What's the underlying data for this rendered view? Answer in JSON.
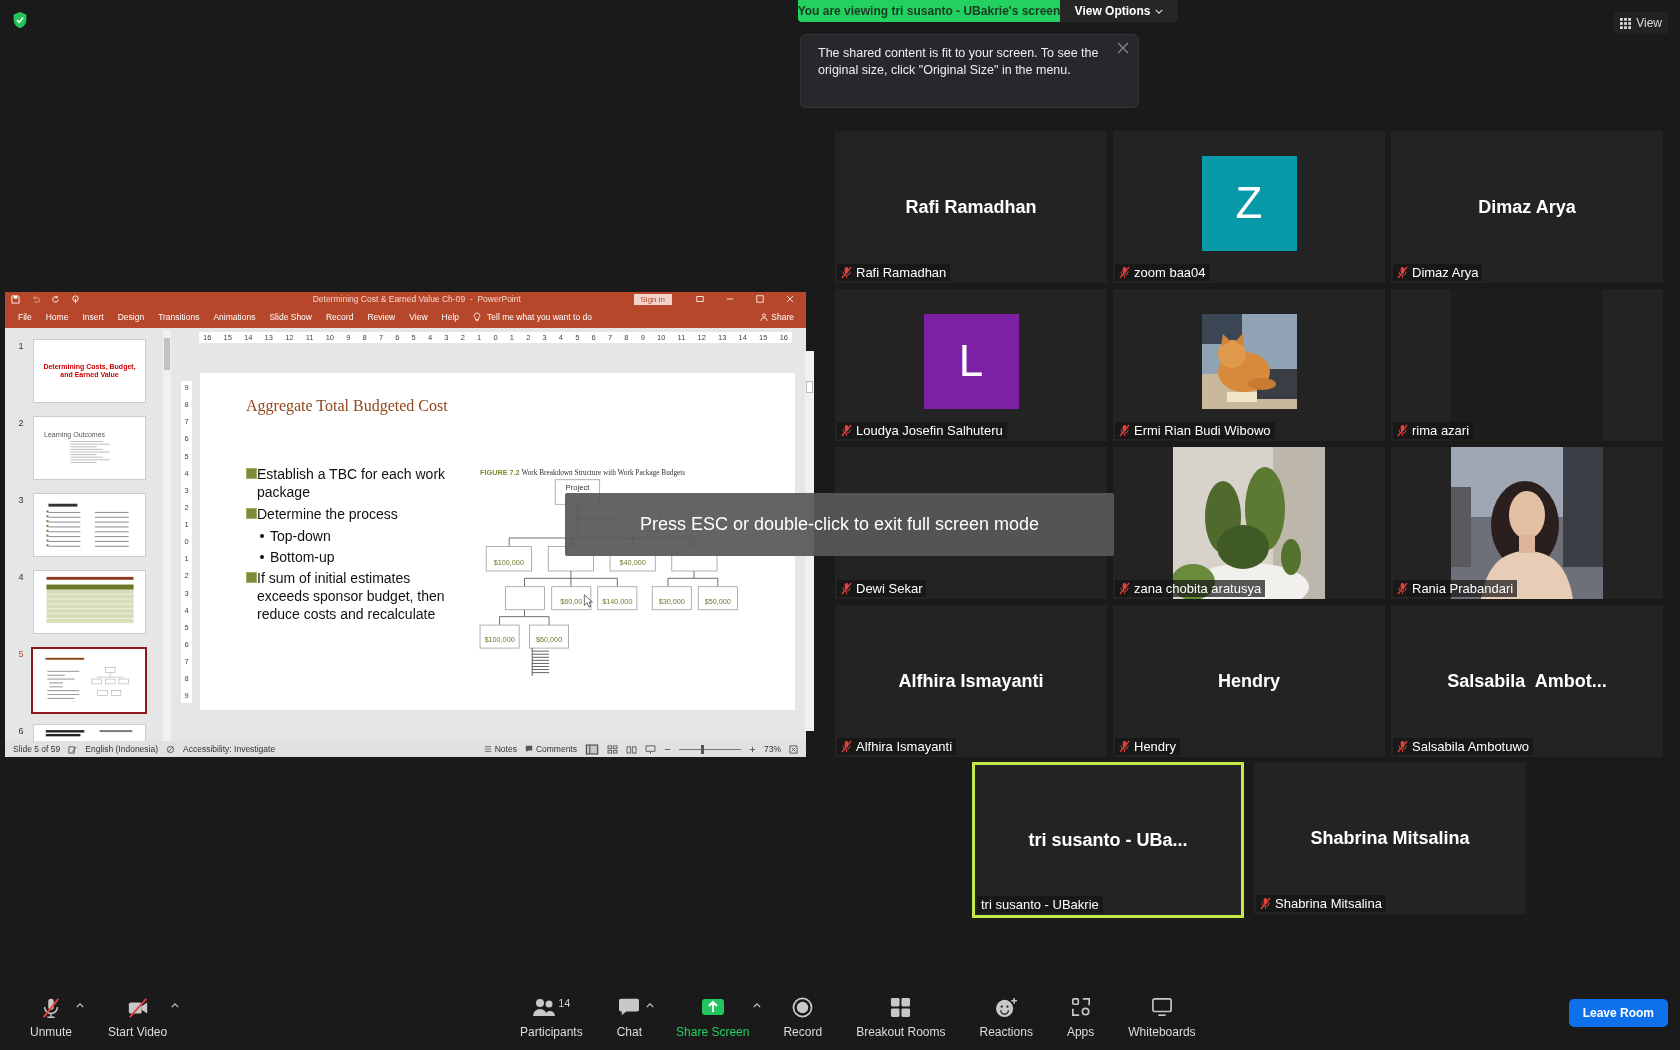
{
  "banner": {
    "text": "You are viewing tri susanto - UBakrie's screen",
    "options": "View Options"
  },
  "tooltip": {
    "text": "The shared content is fit to your screen. To see the original size, click \"Original Size\" in the menu."
  },
  "view_button": "View",
  "fullscreen_hint": "Press ESC or double-click to exit full screen mode",
  "powerpoint": {
    "title": "Determining Cost & Earned Value Ch-09  -  PowerPoint",
    "sign_in": "Sign in",
    "tabs": [
      "File",
      "Home",
      "Insert",
      "Design",
      "Transitions",
      "Animations",
      "Slide Show",
      "Record",
      "Review",
      "View",
      "Help"
    ],
    "tell_me": "Tell me what you want to do",
    "share": "Share",
    "thumbnails": [
      {
        "number": "1",
        "kind": "title",
        "title": "Determining Costs, Budget, and Earned Value",
        "selected": false
      },
      {
        "number": "2",
        "kind": "bullets",
        "title": "Learning Outcomes",
        "selected": false
      },
      {
        "number": "3",
        "kind": "columns",
        "selected": false
      },
      {
        "number": "4",
        "kind": "table",
        "selected": false
      },
      {
        "number": "5",
        "kind": "diagram",
        "selected": true
      },
      {
        "number": "6",
        "kind": "heading",
        "selected": false
      }
    ],
    "ruler_h": [
      "16",
      "15",
      "14",
      "13",
      "12",
      "11",
      "10",
      "9",
      "8",
      "7",
      "6",
      "5",
      "4",
      "3",
      "2",
      "1",
      "0",
      "1",
      "2",
      "3",
      "4",
      "5",
      "6",
      "7",
      "8",
      "9",
      "10",
      "11",
      "12",
      "13",
      "14",
      "15",
      "16"
    ],
    "ruler_v": [
      "9",
      "8",
      "7",
      "6",
      "5",
      "4",
      "3",
      "2",
      "1",
      "0",
      "1",
      "2",
      "3",
      "4",
      "5",
      "6",
      "7",
      "8",
      "9"
    ],
    "slide": {
      "title": "Aggregate Total Budgeted Cost",
      "bullets": [
        {
          "kind": "main",
          "text": "Establish a TBC for each work package"
        },
        {
          "kind": "main",
          "text": "Determine the process"
        },
        {
          "kind": "sub",
          "text": "Top-down"
        },
        {
          "kind": "sub",
          "text": "Bottom-up"
        },
        {
          "kind": "main",
          "text": "If sum of initial estimates exceeds sponsor budget, then reduce costs and recalculate"
        }
      ],
      "figure": {
        "label": "FIGURE 7.2",
        "caption": "Work Breakdown Structure with Work Package Budgets",
        "nodes": [
          {
            "kind": "labeled",
            "label": "Project"
          },
          {
            "kind": "empty"
          },
          {
            "kind": "labeled",
            "label": "$100,000"
          },
          {
            "kind": "empty"
          },
          {
            "kind": "labeled",
            "label": "$40,000"
          },
          {
            "kind": "empty"
          },
          {
            "kind": "empty"
          },
          {
            "kind": "labeled",
            "label": "$60,00"
          },
          {
            "kind": "labeled",
            "label": "$140,000"
          },
          {
            "kind": "labeled",
            "label": "$30,000"
          },
          {
            "kind": "labeled",
            "label": "$50,000"
          },
          {
            "kind": "labeled",
            "label": "$100,000"
          },
          {
            "kind": "labeled",
            "label": "$60,000"
          }
        ]
      }
    },
    "status": {
      "slide": "Slide 5 of 59",
      "language": "English (Indonesia)",
      "accessibility": "Accessibility: Investigate",
      "notes": "Notes",
      "comments": "Comments",
      "zoom": "73%"
    },
    "zoom_slider": {
      "level": 0.35
    }
  },
  "tile_rows": [
    [
      {
        "kind": "name",
        "name": "Rafi Ramadhan",
        "label": "Rafi Ramadhan",
        "muted": true,
        "speaking": false
      },
      {
        "kind": "avatar",
        "letter": "Z",
        "color": "#0899a9",
        "label": "zoom baa04",
        "muted": true,
        "speaking": false
      },
      {
        "kind": "name",
        "name": "Dimaz Arya",
        "label": "Dimaz Arya",
        "muted": true,
        "speaking": false
      }
    ],
    [
      {
        "kind": "avatar",
        "letter": "L",
        "color": "#7c21a6",
        "label": "Loudya Josefin Salhuteru",
        "muted": true,
        "speaking": false
      },
      {
        "kind": "picture",
        "label": "Ermi Rian Budi Wibowo",
        "muted": true,
        "speaking": false
      },
      {
        "kind": "video_off",
        "label": "rima azari",
        "muted": true,
        "speaking": false
      }
    ],
    [
      {
        "kind": "name",
        "label": "Dewi Sekar",
        "muted": true,
        "speaking": false
      },
      {
        "kind": "picture",
        "label": "zana chobita aratusya",
        "muted": true,
        "speaking": false
      },
      {
        "kind": "picture",
        "label": "Rania Prabandari",
        "muted": true,
        "speaking": false
      }
    ],
    [
      {
        "kind": "name",
        "name": "Alfhira Ismayanti",
        "label": "Alfhira Ismayanti",
        "muted": true,
        "speaking": false
      },
      {
        "kind": "name",
        "name": "Hendry",
        "label": "Hendry",
        "muted": true,
        "speaking": false
      },
      {
        "kind": "name",
        "name": "Salsabila  Ambot...",
        "label": "Salsabila Ambotuwo",
        "muted": true,
        "speaking": false
      }
    ],
    [
      {
        "kind": "name",
        "name": "tri susanto - UBa...",
        "label": "tri susanto - UBakrie",
        "muted": false,
        "speaking": true
      },
      {
        "kind": "name",
        "name": "Shabrina Mitsalina",
        "label": "Shabrina Mitsalina",
        "muted": true,
        "speaking": false
      }
    ]
  ],
  "toolbar": {
    "left": [
      {
        "kind": "mic",
        "label": "Unmute",
        "off": true,
        "caret": true
      },
      {
        "kind": "video",
        "label": "Start Video",
        "off": true,
        "caret": true
      }
    ],
    "center": [
      {
        "kind": "participants",
        "label": "Participants",
        "count": "14",
        "caret": false
      },
      {
        "kind": "chat",
        "label": "Chat",
        "caret": true
      },
      {
        "kind": "share",
        "label": "Share Screen",
        "caret": true
      },
      {
        "kind": "record",
        "label": "Record",
        "caret": false
      },
      {
        "kind": "breakout",
        "label": "Breakout Rooms",
        "caret": false
      },
      {
        "kind": "reactions",
        "label": "Reactions",
        "caret": false
      },
      {
        "kind": "apps",
        "label": "Apps",
        "caret": false
      },
      {
        "kind": "whiteboards",
        "label": "Whiteboards",
        "caret": false
      }
    ],
    "leave": "Leave Room"
  }
}
